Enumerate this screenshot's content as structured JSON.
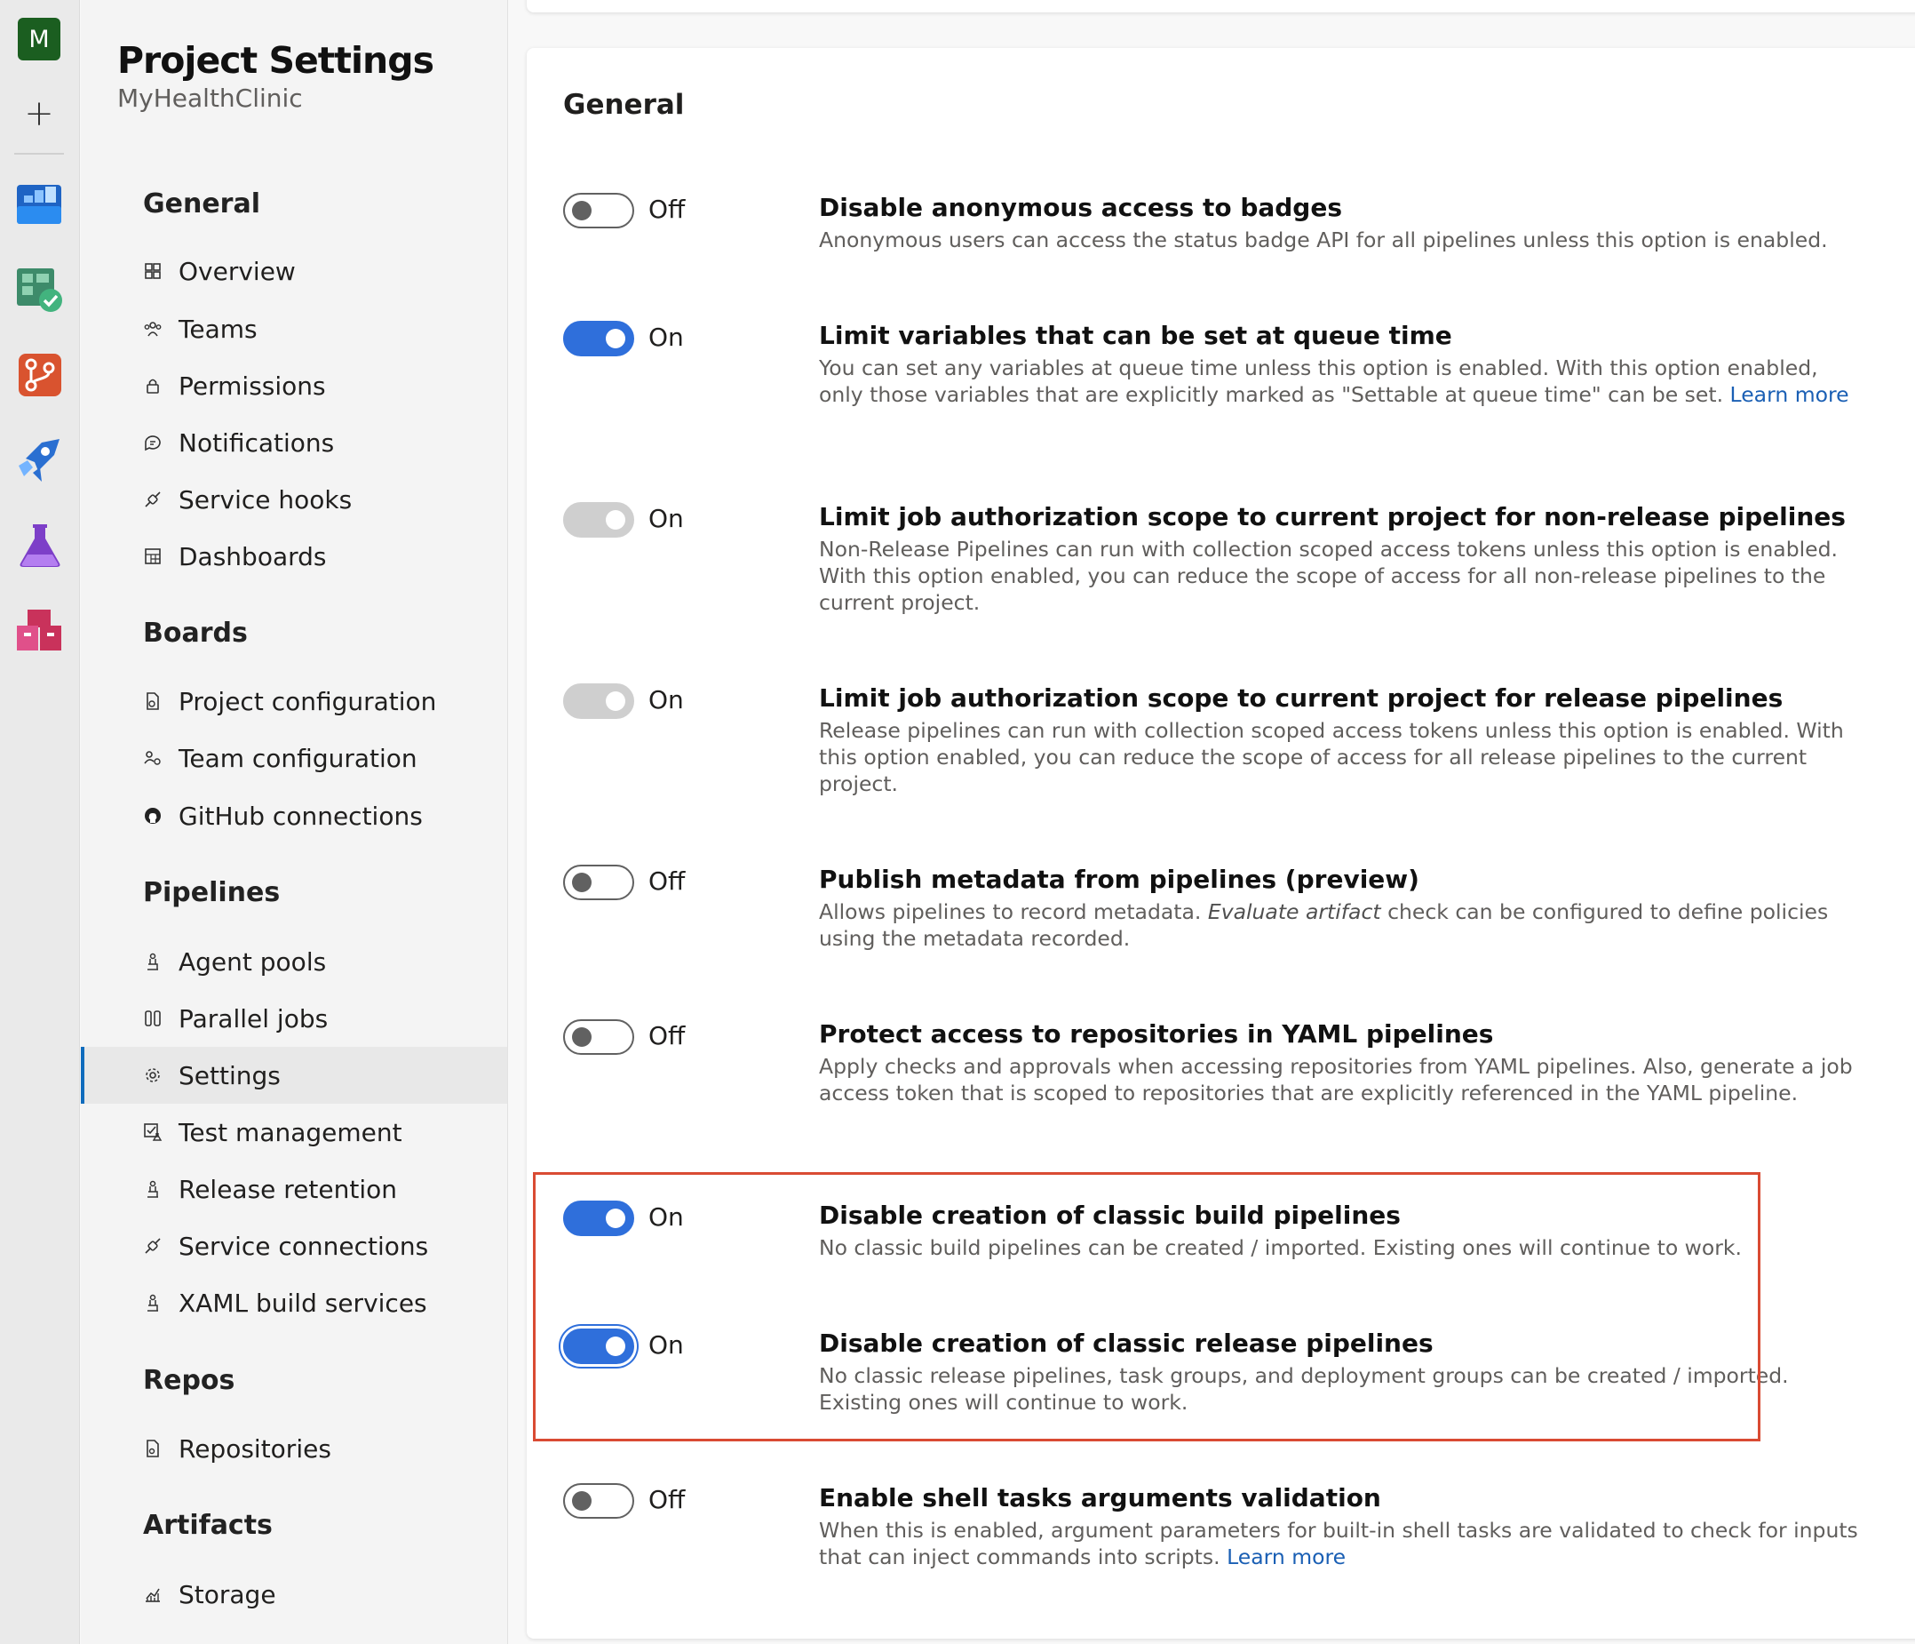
{
  "rail": {
    "avatar_letter": "M",
    "add_symbol": "+",
    "icons": [
      "boards-icon",
      "test-plans-check-icon",
      "repos-icon",
      "pipelines-icon",
      "test-flask-icon",
      "artifacts-icon"
    ]
  },
  "sidebar": {
    "title": "Project Settings",
    "subtitle": "MyHealthClinic",
    "sections": [
      {
        "heading": "General",
        "items": [
          {
            "label": "Overview",
            "icon": "overview-icon"
          },
          {
            "label": "Teams",
            "icon": "teams-icon"
          },
          {
            "label": "Permissions",
            "icon": "lock-icon"
          },
          {
            "label": "Notifications",
            "icon": "chat-bubble-icon"
          },
          {
            "label": "Service hooks",
            "icon": "plug-icon"
          },
          {
            "label": "Dashboards",
            "icon": "dashboard-grid-icon"
          }
        ]
      },
      {
        "heading": "Boards",
        "items": [
          {
            "label": "Project configuration",
            "icon": "doc-gear-icon"
          },
          {
            "label": "Team configuration",
            "icon": "team-gear-icon"
          },
          {
            "label": "GitHub connections",
            "icon": "github-icon"
          }
        ]
      },
      {
        "heading": "Pipelines",
        "items": [
          {
            "label": "Agent pools",
            "icon": "agent-icon"
          },
          {
            "label": "Parallel jobs",
            "icon": "parallel-icon"
          },
          {
            "label": "Settings",
            "icon": "gear-icon",
            "selected": true
          },
          {
            "label": "Test management",
            "icon": "test-management-icon"
          },
          {
            "label": "Release retention",
            "icon": "agent-icon"
          },
          {
            "label": "Service connections",
            "icon": "plug-icon"
          },
          {
            "label": "XAML build services",
            "icon": "agent-icon"
          }
        ]
      },
      {
        "heading": "Repos",
        "items": [
          {
            "label": "Repositories",
            "icon": "repo-doc-icon"
          }
        ]
      },
      {
        "heading": "Artifacts",
        "items": [
          {
            "label": "Storage",
            "icon": "chart-line-icon"
          }
        ]
      }
    ]
  },
  "main": {
    "section_title": "General",
    "settings": [
      {
        "state": "off",
        "state_label": "Off",
        "title": "Disable anonymous access to badges",
        "description": "Anonymous users can access the status badge API for all pipelines unless this option is enabled."
      },
      {
        "state": "on",
        "state_label": "On",
        "title": "Limit variables that can be set at queue time",
        "description": "You can set any variables at queue time unless this option is enabled. With this option enabled, only those variables that are explicitly marked as \"Settable at queue time\" can be set.",
        "link": "Learn more"
      },
      {
        "state": "disabled",
        "state_label": "On",
        "title": "Limit job authorization scope to current project for non-release pipelines",
        "description": "Non-Release Pipelines can run with collection scoped access tokens unless this option is enabled. With this option enabled, you can reduce the scope of access for all non-release pipelines to the current project."
      },
      {
        "state": "disabled",
        "state_label": "On",
        "title": "Limit job authorization scope to current project for release pipelines",
        "description": "Release pipelines can run with collection scoped access tokens unless this option is enabled. With this option enabled, you can reduce the scope of access for all release pipelines to the current project."
      },
      {
        "state": "off",
        "state_label": "Off",
        "title": "Publish metadata from pipelines (preview)",
        "description_pre": "Allows pipelines to record metadata.",
        "description_em": "Evaluate artifact",
        "description_post": "check can be configured to define policies using the metadata recorded."
      },
      {
        "state": "off",
        "state_label": "Off",
        "title": "Protect access to repositories in YAML pipelines",
        "description": "Apply checks and approvals when accessing repositories from YAML pipelines. Also, generate a job access token that is scoped to repositories that are explicitly referenced in the YAML pipeline."
      },
      {
        "state": "on",
        "state_label": "On",
        "title": "Disable creation of classic build pipelines",
        "description": "No classic build pipelines can be created / imported. Existing ones will continue to work."
      },
      {
        "state": "on",
        "state_label": "On",
        "title": "Disable creation of classic release pipelines",
        "description": "No classic release pipelines, task groups, and deployment groups can be created / imported. Existing ones will continue to work."
      },
      {
        "state": "off",
        "state_label": "Off",
        "title": "Enable shell tasks arguments validation",
        "description": "When this is enabled, argument parameters for built-in shell tasks are validated to check for inputs that can inject commands into scripts.",
        "link": "Learn more"
      }
    ]
  },
  "colors": {
    "accent": "#2f6fdb",
    "highlight": "#d94b33",
    "link": "#1a5fb4"
  }
}
